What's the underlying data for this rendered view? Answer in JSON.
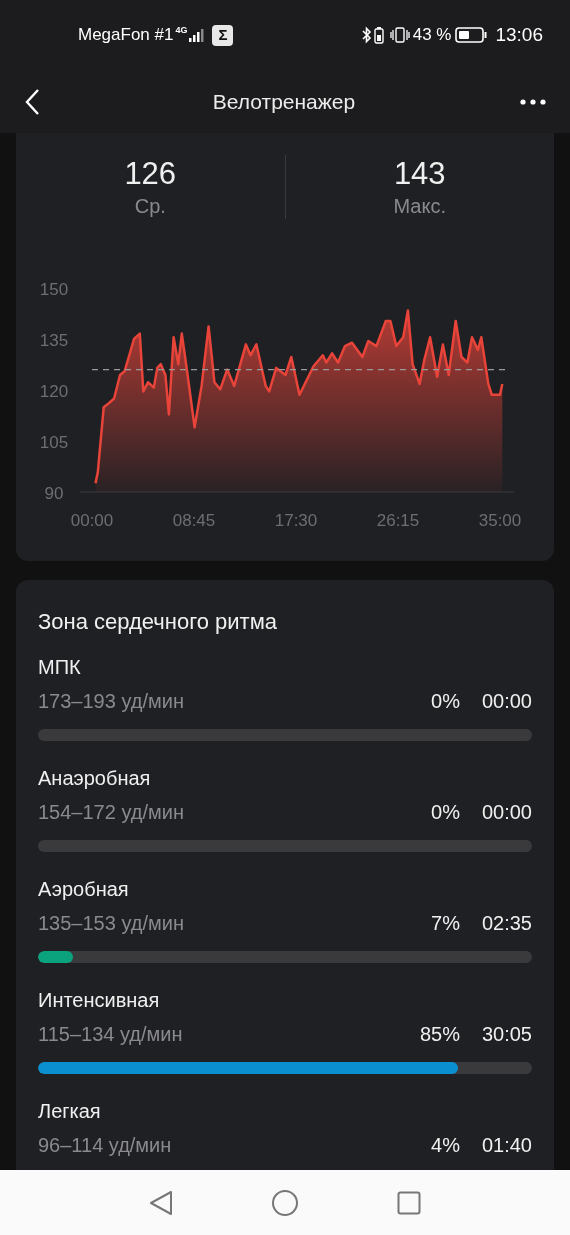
{
  "status_bar": {
    "carrier": "MegaFon #1",
    "network": "4G",
    "app_icon": "Σ",
    "battery": "43 %",
    "time": "13:06"
  },
  "header": {
    "title": "Велотренажер"
  },
  "summary": [
    {
      "value": "126",
      "label": "Ср."
    },
    {
      "value": "143",
      "label": "Макс."
    }
  ],
  "chart_data": {
    "type": "area",
    "xlim": [
      0,
      35.5
    ],
    "ylim": [
      90,
      150
    ],
    "yticks": [
      90,
      105,
      120,
      135,
      150
    ],
    "xticks": [
      {
        "value": 0,
        "label": "00:00"
      },
      {
        "value": 8.75,
        "label": "08:45"
      },
      {
        "value": 17.5,
        "label": "17:30"
      },
      {
        "value": 26.25,
        "label": "26:15"
      },
      {
        "value": 35,
        "label": "35:00"
      }
    ],
    "x": [
      0.3,
      0.5,
      1.0,
      1.4,
      1.9,
      2.4,
      2.8,
      3.6,
      4.1,
      4.4,
      4.8,
      5.3,
      5.6,
      5.9,
      6.3,
      6.6,
      7.0,
      7.4,
      7.7,
      8.2,
      8.8,
      9.4,
      10.0,
      10.5,
      11.0,
      11.6,
      12.2,
      13.2,
      13.6,
      14.1,
      14.9,
      15.2,
      15.8,
      16.6,
      17.1,
      17.8,
      18.4,
      19.0,
      19.8,
      20.1,
      20.6,
      21.1,
      21.7,
      22.3,
      23.2,
      23.7,
      24.4,
      25.2,
      25.6,
      26.1,
      26.7,
      27.1,
      27.5,
      28.1,
      28.5,
      29.0,
      29.6,
      30.1,
      30.6,
      31.2,
      31.7,
      32.2,
      32.6,
      33.1,
      33.4,
      34.0,
      34.3,
      35.0,
      35.2
    ],
    "series": [
      {
        "color": "#e8443a",
        "values": [
          92.6,
          95.8,
          114.9,
          116,
          117.5,
          124.4,
          125.5,
          135,
          136.6,
          119.6,
          122.3,
          120.7,
          126.5,
          127.6,
          124.4,
          112.8,
          135.5,
          127.6,
          136.6,
          124.4,
          109,
          121.2,
          138.7,
          122.3,
          120.2,
          126,
          121.2,
          133.4,
          130.2,
          133.4,
          121.2,
          119.6,
          126.5,
          124.4,
          129.7,
          118.6,
          122.8,
          127,
          130.2,
          128.1,
          130.8,
          128.1,
          132.9,
          133.9,
          129.7,
          134.4,
          132.9,
          140.3,
          140.3,
          132.9,
          135.5,
          143.4,
          127.6,
          121.8,
          128.7,
          135.5,
          123.9,
          133.4,
          124.4,
          140.3,
          129.7,
          128.1,
          135.5,
          131.8,
          135.5,
          121.8,
          118.6,
          118.6,
          121.8
        ]
      }
    ],
    "ref_lines": [
      {
        "axis": "y",
        "value": 126
      }
    ]
  },
  "zones_card": {
    "title": "Зона сердечного ритма",
    "zones": [
      {
        "name": "МПК",
        "range": "173–193 уд/мин",
        "percent": "0%",
        "time": "00:00",
        "level": 0
      },
      {
        "name": "Анаэробная",
        "range": "154–172 уд/мин",
        "percent": "0%",
        "time": "00:00",
        "level": 0
      },
      {
        "name": "Аэробная",
        "range": "135–153 уд/мин",
        "percent": "7%",
        "time": "02:35",
        "level": 0.07,
        "color": "#0ba37d"
      },
      {
        "name": "Интенсивная",
        "range": "115–134 уд/мин",
        "percent": "85%",
        "time": "30:05",
        "level": 0.85,
        "color": "#0a8fd1"
      },
      {
        "name": "Легкая",
        "range": "96–114 уд/мин",
        "percent": "4%",
        "time": "01:40"
      }
    ]
  }
}
